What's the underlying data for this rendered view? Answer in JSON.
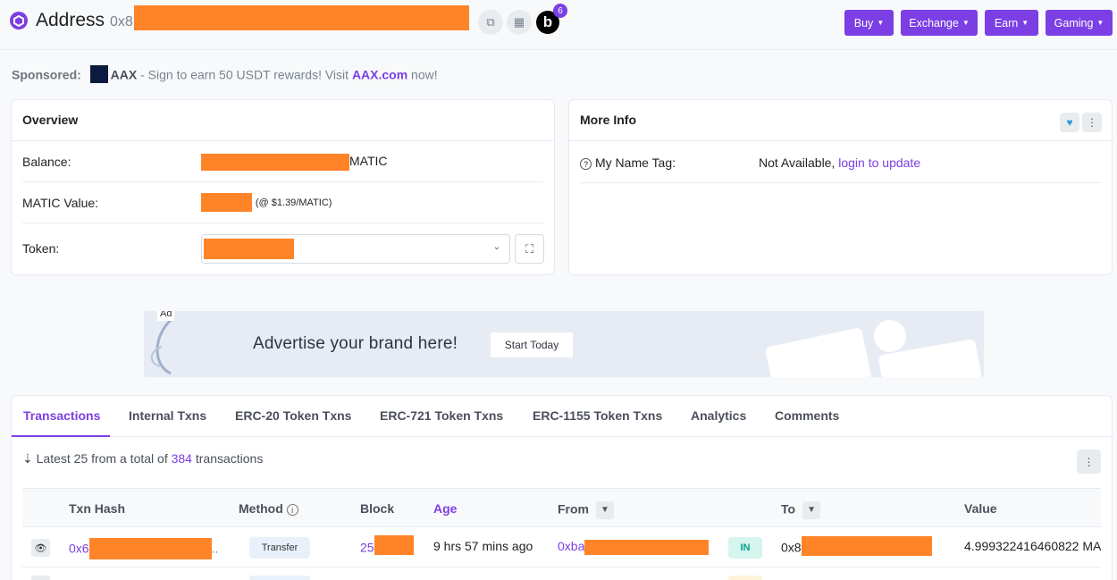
{
  "header": {
    "title": "Address",
    "address_prefix": "0x8",
    "notification_count": "6",
    "badge_letter": "b",
    "buttons": [
      "Buy",
      "Exchange",
      "Earn",
      "Gaming"
    ]
  },
  "sponsored": {
    "label": "Sponsored:",
    "brand": "AAX",
    "text": " - Sign to earn 50 USDT rewards! Visit ",
    "link": "AAX.com",
    "suffix": " now!"
  },
  "overview": {
    "title": "Overview",
    "balance_label": "Balance:",
    "balance_unit": "MATIC",
    "value_label": "MATIC Value:",
    "value_rate": "(@ $1.39/MATIC)",
    "token_label": "Token:"
  },
  "more_info": {
    "title": "More Info",
    "name_tag_label": "My Name Tag:",
    "name_tag_value": "Not Available, ",
    "name_tag_link": "login to update"
  },
  "ad": {
    "label": "Ad",
    "text": "Advertise your brand here!",
    "button": "Start Today"
  },
  "tabs": [
    "Transactions",
    "Internal Txns",
    "ERC-20 Token Txns",
    "ERC-721 Token Txns",
    "ERC-1155 Token Txns",
    "Analytics",
    "Comments"
  ],
  "summary": {
    "prefix": "Latest 25 from a total of ",
    "count": "384",
    "suffix": " transactions"
  },
  "table": {
    "columns": [
      "Txn Hash",
      "Method",
      "Block",
      "Age",
      "From",
      "To",
      "Value"
    ],
    "rows": [
      {
        "hash_prefix": "0x6",
        "method": "Transfer",
        "block_prefix": "25",
        "age": "9 hrs 57 mins ago",
        "from_prefix": "0xba",
        "direction": "IN",
        "to_prefix": "0x8",
        "value": "4.999322416460822 MA"
      }
    ]
  },
  "colors": {
    "accent": "#7b3fe4",
    "redaction": "#ff8428",
    "in_badge": "#00a186"
  }
}
